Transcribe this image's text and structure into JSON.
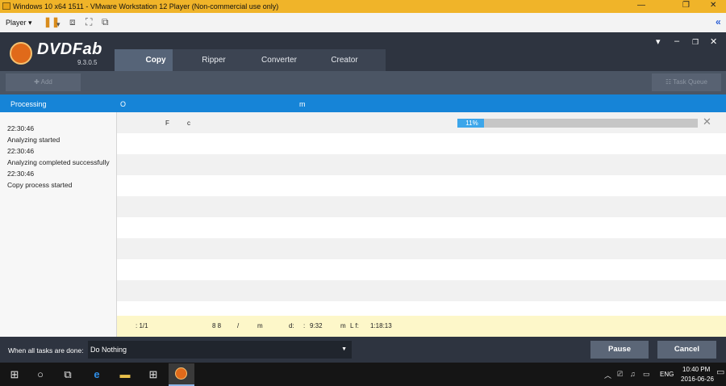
{
  "vm": {
    "title": "Windows 10 x64 1511 - VMware Workstation 12 Player (Non-commercial use only)",
    "minimize": "—",
    "restore": "❐",
    "close": "✕",
    "player_label": "Player",
    "player_caret": "▾",
    "expand_glyph": "«"
  },
  "app": {
    "logo_text": "DVDFab",
    "version": "9.3.0.5",
    "tabs": [
      "Copy",
      "Ripper",
      "Converter",
      "Creator"
    ],
    "active_tab": "Copy",
    "window_menu": "▾",
    "window_min": "–",
    "window_restore": "❐",
    "window_close": "✕"
  },
  "toolbar": {
    "add_label": "✚ Add",
    "task_queue_label": "☷ Task Queue"
  },
  "processing": {
    "label": "Processing",
    "col_a": "O",
    "col_b": "m"
  },
  "log": [
    "22:30:46",
    "Analyzing started",
    "22:30:46",
    "Analyzing completed successfully",
    "22:30:46",
    "Copy process started"
  ],
  "task": {
    "col1": "F",
    "col2": "c",
    "progress_percent": 11,
    "progress_text": "11%",
    "close_glyph": "✕"
  },
  "info": {
    "a": ": 1/1",
    "b": "8 8",
    "c": "/",
    "d": "m",
    "e": "d:",
    "f": ":",
    "g": "9:32",
    "h": "m",
    "i": "L f:",
    "j": "1:18:13"
  },
  "bottom": {
    "when_label": "When all tasks are done:",
    "when_value": "Do Nothing",
    "when_arrow": "▼",
    "pause_label": "Pause",
    "cancel_label": "Cancel"
  },
  "taskbar": {
    "start_glyph": "⊞",
    "search_glyph": "○",
    "taskview_glyph": "⧉",
    "edge_glyph": "e",
    "explorer_glyph": "▬",
    "store_glyph": "⊞",
    "tray_up": "︿",
    "tray_net": "⎚",
    "tray_vol": "♫",
    "tray_msg": "▭",
    "lang": "ENG",
    "time": "10:40 PM",
    "date": "2016-06-26"
  }
}
